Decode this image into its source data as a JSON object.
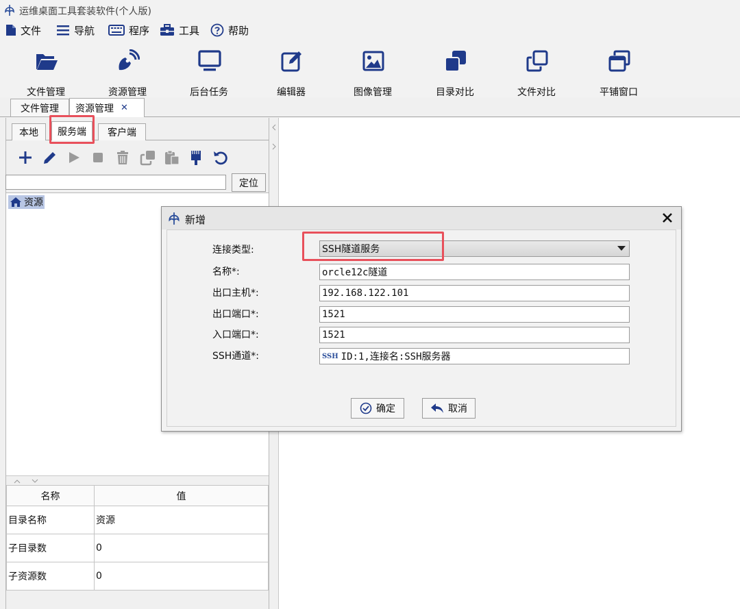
{
  "window": {
    "title": "运维桌面工具套装软件(个人版)"
  },
  "menu": [
    {
      "label": "文件",
      "icon": "file-icon"
    },
    {
      "label": "导航",
      "icon": "hamburger-icon"
    },
    {
      "label": "程序",
      "icon": "keyboard-icon"
    },
    {
      "label": "工具",
      "icon": "toolbox-icon"
    },
    {
      "label": "帮助",
      "icon": "help-icon"
    }
  ],
  "toolbar": [
    {
      "label": "文件管理",
      "icon": "folder-open-icon"
    },
    {
      "label": "资源管理",
      "icon": "satellite-icon"
    },
    {
      "label": "后台任务",
      "icon": "monitor-icon"
    },
    {
      "label": "编辑器",
      "icon": "edit-icon"
    },
    {
      "label": "图像管理",
      "icon": "image-icon"
    },
    {
      "label": "目录对比",
      "icon": "clone-solid-icon"
    },
    {
      "label": "文件对比",
      "icon": "clone-outline-icon"
    },
    {
      "label": "平铺窗口",
      "icon": "window-restore-icon"
    }
  ],
  "main_tabs": [
    {
      "label": "文件管理"
    },
    {
      "label": "资源管理",
      "close": "✕"
    }
  ],
  "sub_tabs": [
    {
      "label": "本地"
    },
    {
      "label": "服务端"
    },
    {
      "label": "客户端"
    }
  ],
  "resource_toolbar": [
    "add-icon",
    "edit-pencil-icon",
    "play-icon",
    "stop-icon",
    "trash-icon",
    "copy-icon",
    "paste-icon",
    "brush-icon",
    "undo-icon"
  ],
  "search": {
    "value": "",
    "button": "定位"
  },
  "tree": {
    "root": "资源"
  },
  "properties": {
    "headers": [
      "名称",
      "值"
    ],
    "rows": [
      [
        "目录名称",
        "资源"
      ],
      [
        "子目录数",
        "0"
      ],
      [
        "子资源数",
        "0"
      ]
    ]
  },
  "dialog": {
    "title": "新增",
    "fields": {
      "conn_type": {
        "label": "连接类型:",
        "value": "SSH隧道服务"
      },
      "name": {
        "label": "名称*:",
        "value": "orcle12c隧道"
      },
      "out_host": {
        "label": "出口主机*:",
        "value": "192.168.122.101"
      },
      "out_port": {
        "label": "出口端口*:",
        "value": "1521"
      },
      "in_port": {
        "label": "入口端口*:",
        "value": "1521"
      },
      "ssh": {
        "label": "SSH通道*:",
        "badge": "SSH",
        "value": "ID:1,连接名:SSH服务器"
      }
    },
    "ok": "确定",
    "cancel": "取消"
  },
  "colors": {
    "icon_blue": "#1f3a8a",
    "highlight_red": "#e8505b",
    "tree_selection": "#b8c6e4"
  }
}
